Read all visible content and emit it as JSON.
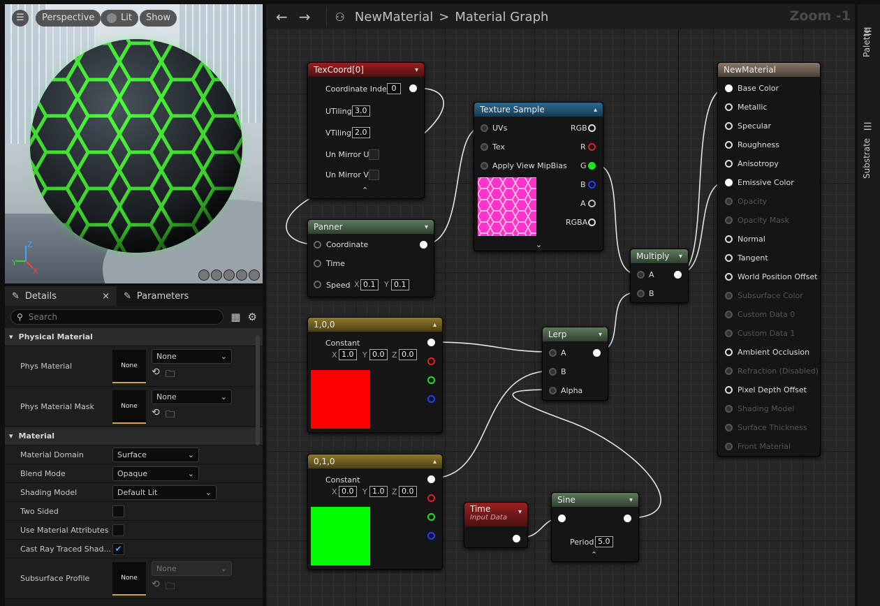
{
  "viewport": {
    "menu_icon": "hamburger-icon",
    "perspective": "Perspective",
    "lit": "Lit",
    "show": "Show",
    "axis_z": "Z",
    "axis_y": "Y",
    "axis_x": "X"
  },
  "details": {
    "tab_details": "Details",
    "tab_close": "×",
    "tab_parameters": "Parameters",
    "search_placeholder": "Search",
    "section_physical": "Physical Material",
    "phys_material": "Phys Material",
    "phys_material_thumb": "None",
    "phys_material_value": "None",
    "phys_material_mask": "Phys Material Mask",
    "phys_mask_thumb": "None",
    "phys_mask_value": "None",
    "section_material": "Material",
    "material_domain": "Material Domain",
    "material_domain_value": "Surface",
    "blend_mode": "Blend Mode",
    "blend_mode_value": "Opaque",
    "shading_model": "Shading Model",
    "shading_model_value": "Default Lit",
    "two_sided": "Two Sided",
    "use_material_attributes": "Use Material Attributes",
    "cast_ray": "Cast Ray Traced Shad...",
    "subsurface_profile": "Subsurface Profile",
    "subsurface_thumb": "None",
    "subsurface_value": "None"
  },
  "graph": {
    "breadcrumb_material": "NewMaterial",
    "breadcrumb_sep": ">",
    "breadcrumb_graph": "Material Graph",
    "zoom": "Zoom -1",
    "texcoord": {
      "title": "TexCoord[0]",
      "coord_index": "Coordinate Index",
      "coord_index_value": "0",
      "utiling": "UTiling",
      "utiling_value": "3.0",
      "vtiling": "VTiling",
      "vtiling_value": "2.0",
      "unmirror_u": "Un Mirror U",
      "unmirror_v": "Un Mirror V"
    },
    "panner": {
      "title": "Panner",
      "coordinate": "Coordinate",
      "time": "Time",
      "speed": "Speed",
      "x": "X",
      "x_value": "0.1",
      "y": "Y",
      "y_value": "0.1"
    },
    "texture": {
      "title": "Texture Sample",
      "uvs": "UVs",
      "tex": "Tex",
      "mip": "Apply View MipBias",
      "rgb": "RGB",
      "r": "R",
      "g": "G",
      "b": "B",
      "a": "A",
      "rgba": "RGBA"
    },
    "const_red": {
      "title": "1,0,0",
      "constant": "Constant",
      "x": "X",
      "x_value": "1.0",
      "y": "Y",
      "y_value": "0.0",
      "z": "Z",
      "z_value": "0.0",
      "color": "#ff0000"
    },
    "const_green": {
      "title": "0,1,0",
      "constant": "Constant",
      "x": "X",
      "x_value": "0.0",
      "y": "Y",
      "y_value": "1.0",
      "z": "Z",
      "z_value": "0.0",
      "color": "#00ff00"
    },
    "lerp": {
      "title": "Lerp",
      "a": "A",
      "b": "B",
      "alpha": "Alpha"
    },
    "multiply": {
      "title": "Multiply",
      "a": "A",
      "b": "B"
    },
    "time": {
      "title": "Time",
      "subtitle": "Input Data"
    },
    "sine": {
      "title": "Sine",
      "period": "Period",
      "period_value": "5.0"
    },
    "result": {
      "title": "NewMaterial",
      "pins": [
        "Base Color",
        "Metallic",
        "Specular",
        "Roughness",
        "Anisotropy",
        "Emissive Color",
        "Opacity",
        "Opacity Mask",
        "Normal",
        "Tangent",
        "World Position Offset",
        "Subsurface Color",
        "Custom Data 0",
        "Custom Data 1",
        "Ambient Occlusion",
        "Refraction (Disabled)",
        "Pixel Depth Offset",
        "Shading Model",
        "Surface Thickness",
        "Front Material"
      ]
    }
  },
  "sidebar": {
    "palette": "Palette",
    "substrate": "Substrate"
  },
  "colors": {
    "hex_glow": "#4cff3a",
    "texture_preview": "#ff33cc"
  }
}
